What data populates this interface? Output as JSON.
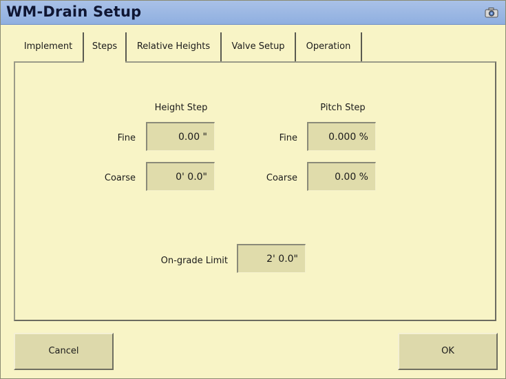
{
  "window": {
    "title": "WM-Drain Setup",
    "title_icon": "camera-icon"
  },
  "tabs": [
    {
      "label": "Implement",
      "active": false
    },
    {
      "label": "Steps",
      "active": true
    },
    {
      "label": "Relative Heights",
      "active": false
    },
    {
      "label": "Valve Setup",
      "active": false
    },
    {
      "label": "Operation",
      "active": false
    }
  ],
  "height_step": {
    "header": "Height Step",
    "fine_label": "Fine",
    "fine_value": "0.00 \"",
    "coarse_label": "Coarse",
    "coarse_value": "0' 0.0\""
  },
  "pitch_step": {
    "header": "Pitch Step",
    "fine_label": "Fine",
    "fine_value": "0.000 %",
    "coarse_label": "Coarse",
    "coarse_value": "0.00 %"
  },
  "on_grade": {
    "label": "On-grade Limit",
    "value": "2' 0.0\""
  },
  "footer": {
    "cancel_label": "Cancel",
    "ok_label": "OK"
  },
  "colors": {
    "background": "#f8f4c6",
    "titlebar": "#9fb9e4",
    "field": "#e0dcab"
  }
}
